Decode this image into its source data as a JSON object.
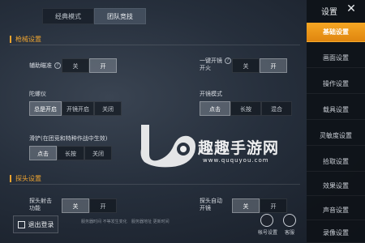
{
  "mode_tabs": [
    "经典模式",
    "团队竞技"
  ],
  "active_mode": 1,
  "sections": {
    "gun": "枪械设置",
    "peek": "探头设置"
  },
  "rows": {
    "assist_aim": {
      "label": "辅助瞄准",
      "options": [
        "关",
        "开"
      ],
      "selected": 1
    },
    "one_key_scope": {
      "label_line1": "一键开镜",
      "label_line2": "开火",
      "options": [
        "关",
        "开"
      ],
      "selected": 1
    },
    "gyro": {
      "label": "陀螺仪",
      "options": [
        "总是开启",
        "开镜开启",
        "关闭"
      ],
      "selected": 0
    },
    "scope_mode": {
      "label": "开镜模式",
      "options": [
        "点击",
        "长按",
        "混合"
      ],
      "selected": 0
    },
    "slide": {
      "label": "滑铲(在团竞和特种作战中生效)",
      "options": [
        "点击",
        "长按",
        "关闭"
      ],
      "selected": 0
    },
    "peek_fire": {
      "label_line1": "探头射击",
      "label_line2": "功能",
      "options": [
        "关",
        "开"
      ],
      "selected": 0
    },
    "peek_auto": {
      "label_line1": "探头自动",
      "label_line2": "开镜",
      "options": [
        "关",
        "开"
      ],
      "selected": 0
    }
  },
  "watermark": {
    "text": "趣趣手游网",
    "url": "www.ququyou.com"
  },
  "bottom": {
    "logout": "退出登录",
    "hint1": "服务器时间 不等发生变化",
    "hint2": "服务器地址 更新时间",
    "btn_a": "帐号设置",
    "btn_b": "客服"
  },
  "sidebar": {
    "title": "设置",
    "close": "✕",
    "items": [
      "基础设置",
      "画面设置",
      "操作设置",
      "载具设置",
      "灵敏度设置",
      "拾取设置",
      "效果设置",
      "声音设置",
      "录像设置"
    ],
    "active": 0
  },
  "colors": {
    "accent": "#f5a623",
    "section": "#f0a530"
  }
}
